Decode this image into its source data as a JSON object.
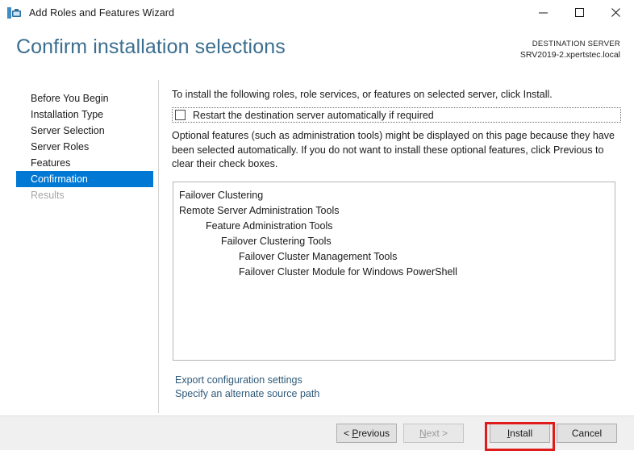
{
  "window": {
    "title": "Add Roles and Features Wizard",
    "icon": "server-tools-icon",
    "controls": {
      "minimize": "minimize-icon",
      "maximize": "maximize-icon",
      "close": "close-icon"
    }
  },
  "header": {
    "page_title": "Confirm installation selections",
    "destination_label": "DESTINATION SERVER",
    "destination_server": "SRV2019-2.xpertstec.local",
    "title_color": "#3b6e8f"
  },
  "sidebar": {
    "items": [
      {
        "label": "Before You Begin",
        "state": "normal"
      },
      {
        "label": "Installation Type",
        "state": "normal"
      },
      {
        "label": "Server Selection",
        "state": "normal"
      },
      {
        "label": "Server Roles",
        "state": "normal"
      },
      {
        "label": "Features",
        "state": "normal"
      },
      {
        "label": "Confirmation",
        "state": "selected"
      },
      {
        "label": "Results",
        "state": "disabled"
      }
    ],
    "selected_color": "#0078d4"
  },
  "main": {
    "intro_text": "To install the following roles, role services, or features on selected server, click Install.",
    "restart_checkbox": {
      "label": "Restart the destination server automatically if required",
      "checked": false
    },
    "optional_note": "Optional features (such as administration tools) might be displayed on this page because they have been selected automatically. If you do not want to install these optional features, click Previous to clear their check boxes.",
    "feature_list": [
      {
        "label": "Failover Clustering",
        "level": 0
      },
      {
        "label": "Remote Server Administration Tools",
        "level": 1
      },
      {
        "label": "Feature Administration Tools",
        "level": 2
      },
      {
        "label": "Failover Clustering Tools",
        "level": 3
      },
      {
        "label": "Failover Cluster Management Tools",
        "level": 4
      },
      {
        "label": "Failover Cluster Module for Windows PowerShell",
        "level": 4
      }
    ],
    "links": [
      {
        "label": "Export configuration settings"
      },
      {
        "label": "Specify an alternate source path"
      }
    ],
    "link_color": "#2f5a7a"
  },
  "buttons": {
    "previous": {
      "prefix": "< ",
      "accel": "P",
      "rest": "revious",
      "enabled": true
    },
    "next": {
      "prefix": "",
      "accel": "N",
      "rest": "ext >",
      "enabled": false
    },
    "install": {
      "prefix": "",
      "accel": "I",
      "rest": "nstall",
      "enabled": true
    },
    "cancel": {
      "prefix": "",
      "accel": "",
      "rest": "Cancel",
      "enabled": true
    }
  },
  "annotation": {
    "highlight_target": "install-button",
    "highlight_color": "#e01b1b"
  }
}
